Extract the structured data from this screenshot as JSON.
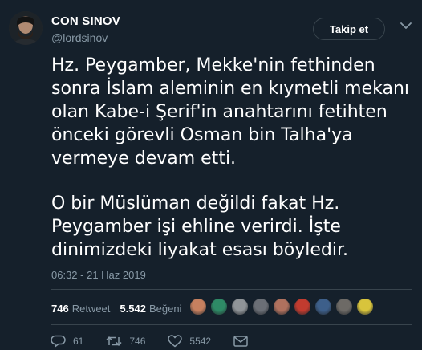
{
  "user": {
    "name": "CON SINOV",
    "handle": "@lordsinov"
  },
  "follow_button": {
    "label": "Takip et"
  },
  "tweet": {
    "paragraphs": [
      "Hz. Peygamber, Mekke'nin fethinden sonra İslam aleminin en kıymetli mekanı olan Kabe-i Şerif'in anahtarını fetihten önceki görevli Osman bin Talha'ya vermeye devam etti.",
      "O bir Müslüman değildi fakat Hz. Peygamber işi ehline verirdi. İşte dinimizdeki liyakat esası böyledir."
    ],
    "timestamp": "06:32 - 21 Haz 2019"
  },
  "stats": {
    "retweet_count": "746",
    "retweet_label": "Retweet",
    "like_count": "5.542",
    "like_label": "Beğeni"
  },
  "liker_avatars": [
    {
      "color": "#c6805f"
    },
    {
      "color": "#2e8a66"
    },
    {
      "color": "#8f9498"
    },
    {
      "color": "#6b6f76"
    },
    {
      "color": "#b0715e"
    },
    {
      "color": "#c23b2f"
    },
    {
      "color": "#3d5f8a"
    },
    {
      "color": "#6d6a66"
    },
    {
      "color": "#d8c43c"
    }
  ],
  "actions": {
    "reply_count": "61",
    "retweet_count": "746",
    "like_count": "5542"
  },
  "colors": {
    "background": "#15202b",
    "secondary_text": "#8899a6",
    "border": "#38444d"
  }
}
